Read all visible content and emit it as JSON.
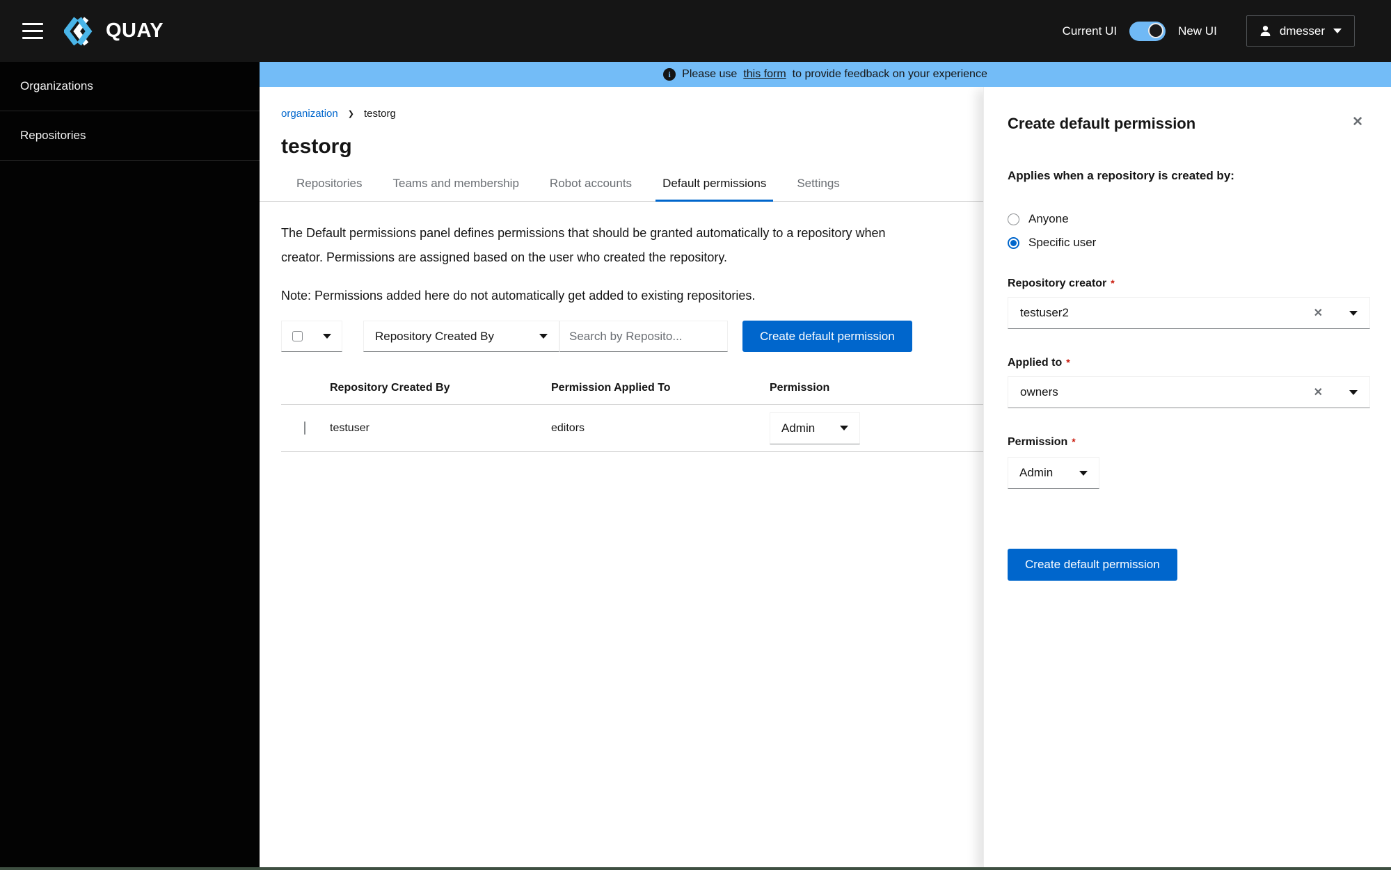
{
  "header": {
    "brand": "QUAY",
    "toggle_left_label": "Current UI",
    "toggle_right_label": "New UI",
    "toggle": {
      "checked": true
    },
    "user": "dmesser"
  },
  "sidebar": {
    "items": [
      {
        "label": "Organizations"
      },
      {
        "label": "Repositories"
      }
    ]
  },
  "banner": {
    "text_prefix": "Please use",
    "link_text": "this form",
    "text_suffix": "to provide feedback on your experience"
  },
  "breadcrumb": {
    "items": [
      {
        "label": "organization"
      },
      {
        "label": "testorg"
      }
    ]
  },
  "page": {
    "title": "testorg"
  },
  "tabs": [
    {
      "label": "Repositories",
      "active": false
    },
    {
      "label": "Teams and membership",
      "active": false
    },
    {
      "label": "Robot accounts",
      "active": false
    },
    {
      "label": "Default permissions",
      "active": true
    },
    {
      "label": "Settings",
      "active": false
    }
  ],
  "content": {
    "description_line1": "The Default permissions panel defines permissions that should be granted automatically to a repository when",
    "description_line2": "creator. Permissions are assigned based on the user who created the repository.",
    "note": "Note: Permissions added here do not automatically get added to existing repositories."
  },
  "toolbar": {
    "filter_label": "Repository Created By",
    "search_placeholder": "Search by Reposito...",
    "create_button": "Create default permission"
  },
  "table": {
    "columns": [
      "Repository Created By",
      "Permission Applied To",
      "Permission"
    ],
    "rows": [
      {
        "repository_created_by": "testuser",
        "permission_applied_to": "editors",
        "permission": "Admin"
      }
    ]
  },
  "drawer": {
    "title": "Create default permission",
    "subtitle": "Applies when a repository is created by:",
    "radio_options": [
      {
        "label": "Anyone",
        "selected": false
      },
      {
        "label": "Specific user",
        "selected": true
      }
    ],
    "repository_creator": {
      "label": "Repository creator",
      "required": "*",
      "value": "testuser2"
    },
    "applied_to": {
      "label": "Applied to",
      "required": "*",
      "value": "owners"
    },
    "permission": {
      "label": "Permission",
      "required": "*",
      "value": "Admin"
    },
    "submit_button": "Create default permission"
  },
  "colors": {
    "accent": "#0066cc",
    "banner_info": "#73bcf7",
    "masthead": "#151515",
    "danger": "#c9190b",
    "logo_blue": "#4ab5e8"
  }
}
